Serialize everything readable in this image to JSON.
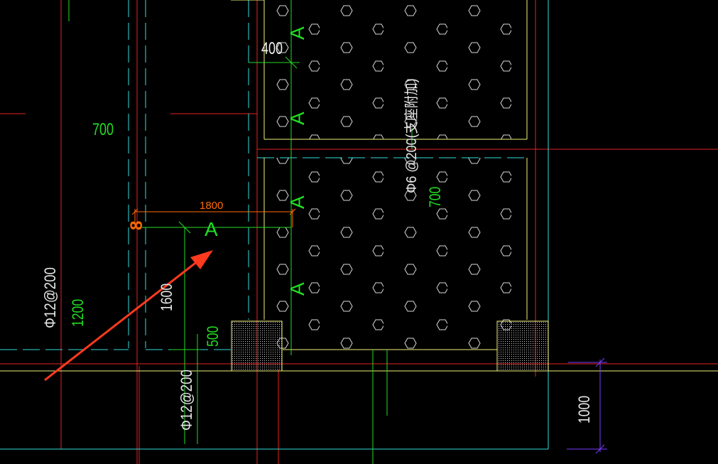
{
  "colors": {
    "background": "#000000",
    "red": "#e52222",
    "cyan": "#33dddd",
    "yellow": "#f2f27a",
    "green": "#22dd22",
    "white": "#e8e8e8",
    "orange": "#ff6a00",
    "purple": "#7a3cff",
    "arrow": "#ff3a1f"
  },
  "labels": {
    "dim_400": "400",
    "dim_700_left": "700",
    "dim_1800": "1800",
    "dim_1600": "1600",
    "dim_500": "500",
    "dim_1200": "1200",
    "dim_700_right": "700",
    "dim_1000": "1000",
    "rebar_left": "Φ12@200",
    "rebar_bottom": "Φ12@200",
    "rebar_hatch": "Φ6 @200(支座附加)",
    "section_a": "A",
    "orange_mark": "8"
  }
}
